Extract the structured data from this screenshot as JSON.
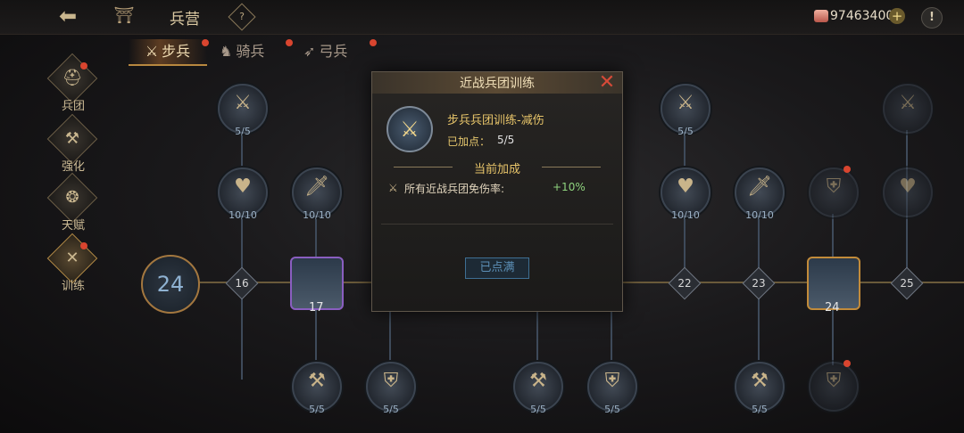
{
  "topbar": {
    "back_icon": "back-arrow-icon",
    "barracks_icon": "barracks-icon",
    "title": "兵营",
    "help_icon": "question-icon",
    "currency_value": "97463400",
    "currency_plus": "+",
    "info": "!"
  },
  "tabs": [
    {
      "label": "步兵",
      "icon": "sword-icon",
      "active": true
    },
    {
      "label": "骑兵",
      "icon": "horse-icon",
      "active": false
    },
    {
      "label": "弓兵",
      "icon": "bow-icon",
      "active": false
    }
  ],
  "sidebar": {
    "items": [
      {
        "label": "兵团",
        "icon": "helmet-icon"
      },
      {
        "label": "强化",
        "icon": "anvil-icon"
      },
      {
        "label": "天赋",
        "icon": "talent-icon"
      },
      {
        "label": "训练",
        "icon": "crossed-swords-icon"
      }
    ]
  },
  "tree": {
    "current_level": "24",
    "row1_counts": [
      "5/5",
      "5/5"
    ],
    "row2_counts": [
      "10/10",
      "10/10",
      "10/10",
      "10/10"
    ],
    "row4_counts": [
      "5/5",
      "5/5",
      "5/5",
      "5/5",
      "5/5"
    ],
    "levels": [
      "16",
      "17",
      "22",
      "23",
      "24",
      "25"
    ]
  },
  "modal": {
    "title": "近战兵团训练",
    "skill_name": "步兵兵团训练-减伤",
    "points_label": "已加点：",
    "points_value": "5/5",
    "section_title": "当前加成",
    "bonus_label": "所有近战兵团免伤率:",
    "bonus_value": "+10%",
    "button_label": "已点满"
  },
  "colors": {
    "accent_gold": "#e8c56a",
    "bonus_green": "#8fd37e",
    "close_red": "#d64a38",
    "notification_red": "#d9452f"
  }
}
